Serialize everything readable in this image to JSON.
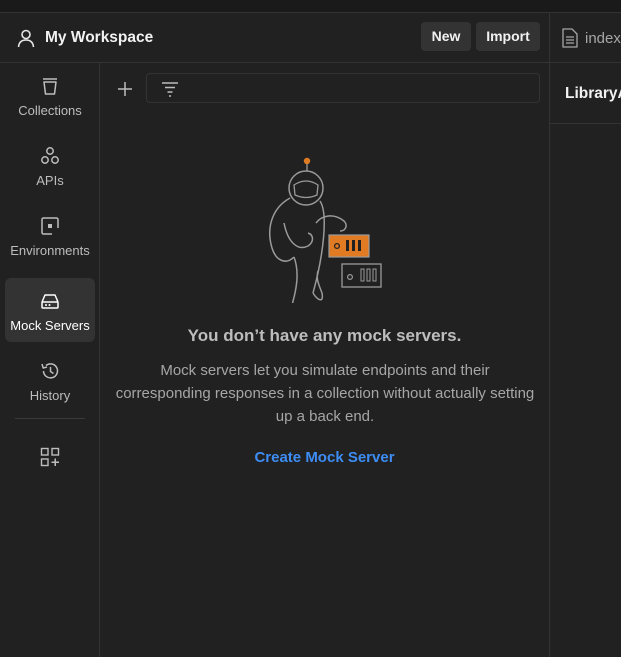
{
  "workspace": {
    "title": "My Workspace"
  },
  "header": {
    "new_label": "New",
    "import_label": "Import"
  },
  "sidebar": {
    "items": [
      {
        "label": "Collections",
        "icon": "collections-icon"
      },
      {
        "label": "APIs",
        "icon": "apis-icon"
      },
      {
        "label": "Environments",
        "icon": "environments-icon"
      },
      {
        "label": "Mock Servers",
        "icon": "mock-servers-icon",
        "active": true
      },
      {
        "label": "History",
        "icon": "history-icon"
      }
    ]
  },
  "empty_state": {
    "title": "You don’t have any mock servers.",
    "description": "Mock servers let you simulate endpoints and their corresponding responses in a collection without actually setting up a back end.",
    "action": "Create Mock Server"
  },
  "right_pane": {
    "tab_label": "index",
    "request_title": "LibraryA"
  },
  "colors": {
    "background": "#212121",
    "accent_link": "#3d8df5",
    "server_orange": "#e07b24"
  }
}
